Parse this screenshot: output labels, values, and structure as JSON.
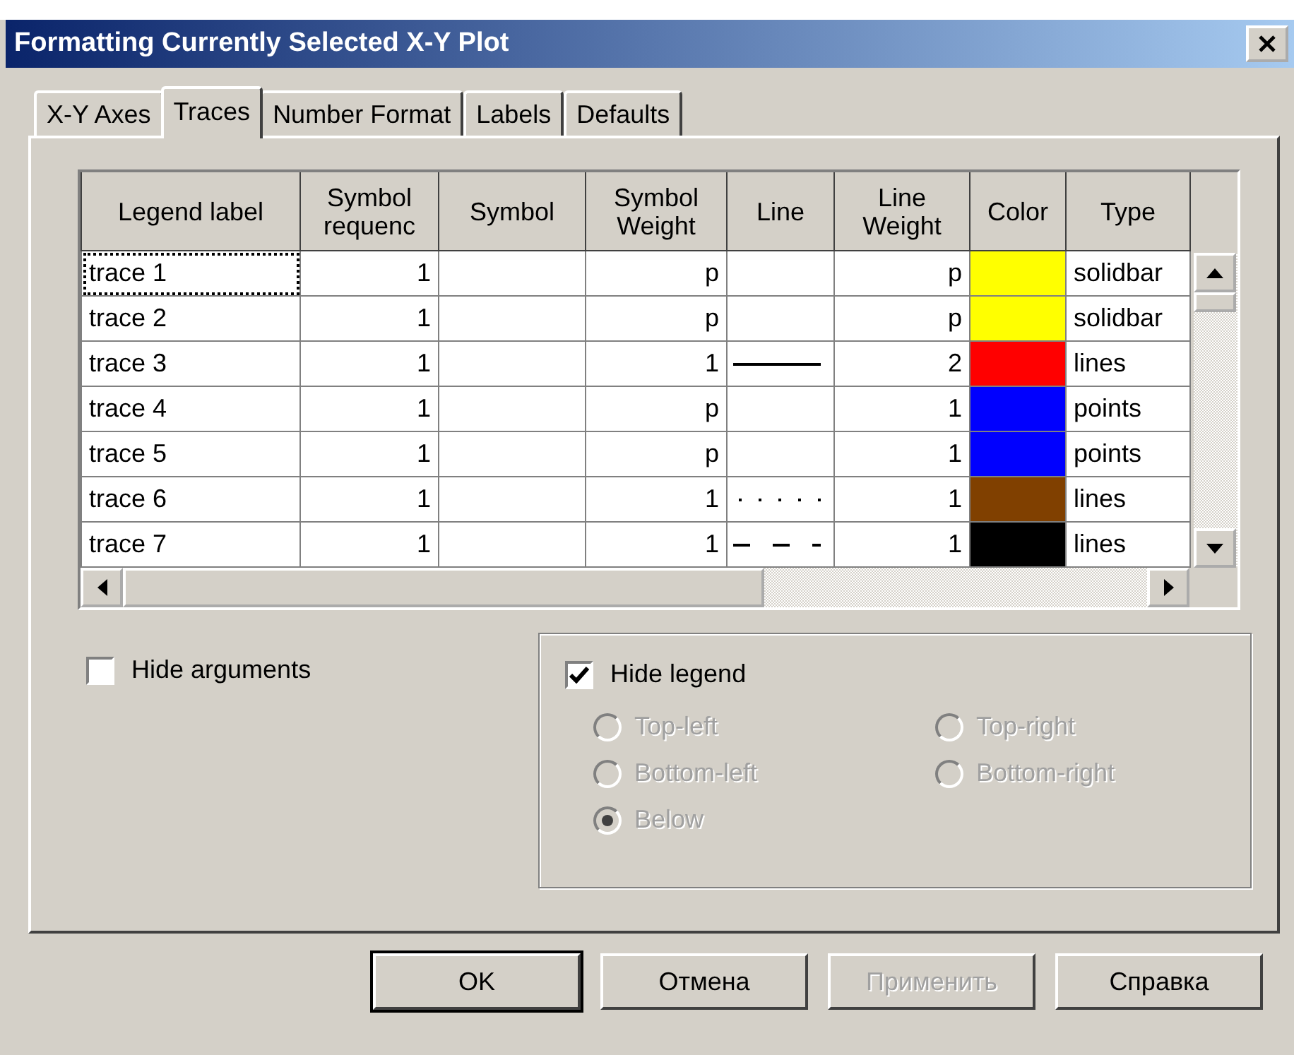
{
  "window": {
    "title": "Formatting Currently Selected X-Y Plot"
  },
  "tabs": [
    {
      "label": "X-Y Axes",
      "selected": false
    },
    {
      "label": "Traces",
      "selected": true
    },
    {
      "label": "Number Format",
      "selected": false
    },
    {
      "label": "Labels",
      "selected": false
    },
    {
      "label": "Defaults",
      "selected": false
    }
  ],
  "table": {
    "columns": [
      "Legend label",
      "Symbol\nrequenc",
      "Symbol",
      "Symbol\nWeight",
      "Line",
      "Line\nWeight",
      "Color",
      "Type"
    ],
    "rows": [
      {
        "label": "trace 1",
        "frequency": "1",
        "symbol_weight": "p",
        "line_weight": "p",
        "color": "#ffff00",
        "type": "solidbar",
        "selected": true
      },
      {
        "label": "trace 2",
        "frequency": "1",
        "symbol_weight": "p",
        "line_weight": "p",
        "color": "#ffff00",
        "type": "solidbar",
        "selected": false
      },
      {
        "label": "trace 3",
        "frequency": "1",
        "symbol_weight": "1",
        "line": {
          "kind": "solid"
        },
        "line_weight": "2",
        "color": "#ff0000",
        "type": "lines",
        "selected": false
      },
      {
        "label": "trace 4",
        "frequency": "1",
        "symbol_weight": "p",
        "line_weight": "1",
        "color": "#0000ff",
        "type": "points",
        "selected": false
      },
      {
        "label": "trace 5",
        "frequency": "1",
        "symbol_weight": "p",
        "line_weight": "1",
        "color": "#0000ff",
        "type": "points",
        "selected": false
      },
      {
        "label": "trace 6",
        "frequency": "1",
        "symbol_weight": "1",
        "line": {
          "kind": "dotted"
        },
        "line_weight": "1",
        "color": "#804000",
        "type": "lines",
        "selected": false
      },
      {
        "label": "trace 7",
        "frequency": "1",
        "symbol_weight": "1",
        "line": {
          "kind": "dashed"
        },
        "line_weight": "1",
        "color": "#000000",
        "type": "lines",
        "selected": false
      }
    ]
  },
  "hide_arguments": {
    "label": "Hide arguments",
    "checked": false
  },
  "legend": {
    "hide_legend": {
      "label": "Hide legend",
      "checked": true
    },
    "positions": [
      {
        "label": "Top-left",
        "selected": false,
        "disabled": true
      },
      {
        "label": "Top-right",
        "selected": false,
        "disabled": true
      },
      {
        "label": "Bottom-left",
        "selected": false,
        "disabled": true
      },
      {
        "label": "Bottom-right",
        "selected": false,
        "disabled": true
      },
      {
        "label": "Below",
        "selected": true,
        "disabled": true
      }
    ]
  },
  "buttons": [
    {
      "label": "OK",
      "default": true,
      "disabled": false
    },
    {
      "label": "Отмена",
      "default": false,
      "disabled": false
    },
    {
      "label": "Применить",
      "default": false,
      "disabled": true
    },
    {
      "label": "Справка",
      "default": false,
      "disabled": false
    }
  ]
}
